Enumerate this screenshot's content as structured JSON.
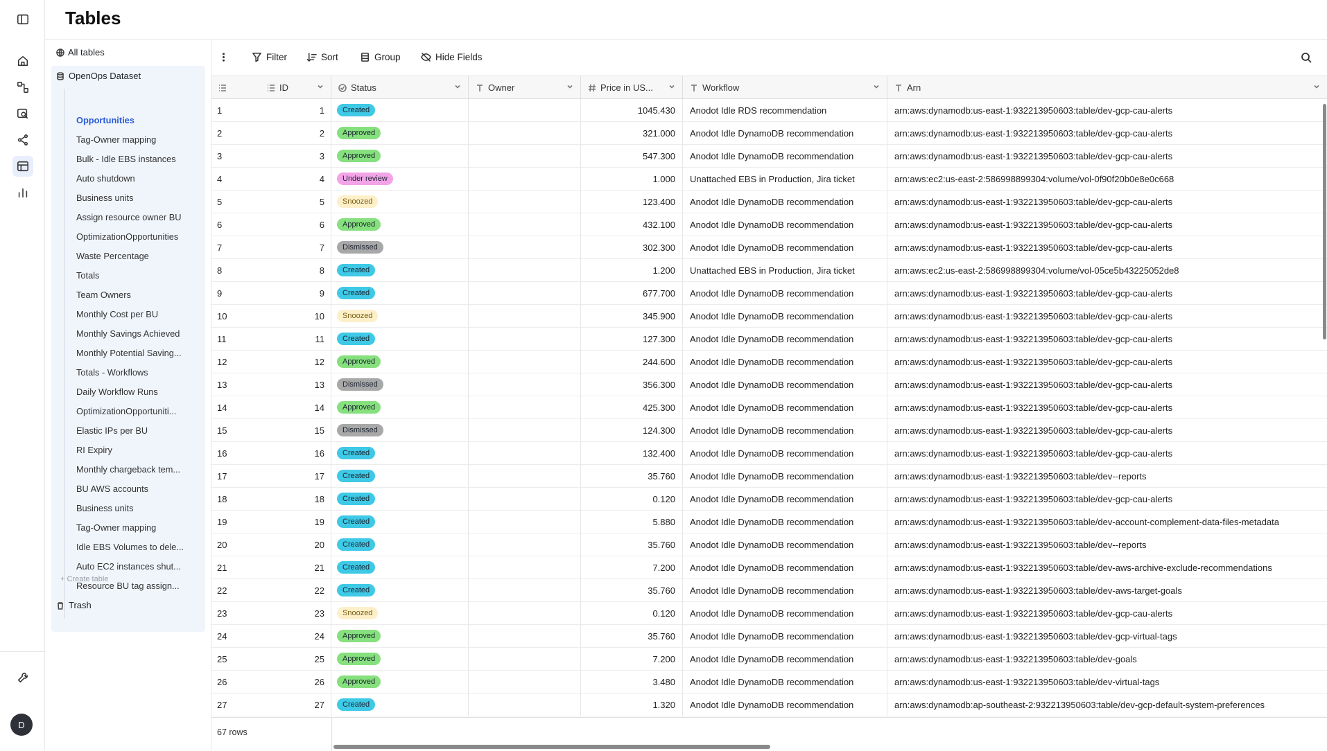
{
  "header": {
    "title": "Tables"
  },
  "sidebar": {
    "all_tables": "All tables",
    "dataset": "OpenOps Dataset",
    "tables": [
      "Opportunities",
      "Tag-Owner mapping",
      "Bulk - Idle EBS instances",
      "Auto shutdown",
      "Business units",
      "Assign resource owner BU",
      "OptimizationOpportunities",
      "Waste Percentage",
      "Totals",
      "Team Owners",
      "Monthly Cost per BU",
      "Monthly Savings Achieved",
      "Monthly Potential Saving...",
      "Totals - Workflows",
      "Daily Workflow Runs",
      "OptimizationOpportuniti...",
      "Elastic IPs per BU",
      "RI Expiry",
      "Monthly chargeback tem...",
      "BU AWS accounts",
      "Business units",
      "Tag-Owner mapping",
      "Idle EBS Volumes to dele...",
      "Auto EC2 instances shut...",
      "Resource BU tag assign..."
    ],
    "active_table": "Opportunities",
    "create_table": "+ Create table",
    "trash": "Trash"
  },
  "toolbar": {
    "filter": "Filter",
    "sort": "Sort",
    "group": "Group",
    "hide_fields": "Hide Fields"
  },
  "columns": {
    "id": "ID",
    "status": "Status",
    "owner": "Owner",
    "price": "Price in US...",
    "workflow": "Workflow",
    "arn": "Arn"
  },
  "status_colors": {
    "Created": "#3ec9e6",
    "Approved": "#86e07d",
    "Under review": "#f3a4e8",
    "Snoozed": "#fdf0c8",
    "Dismissed": "#a8a8a8"
  },
  "rows": [
    {
      "n": "1",
      "id": "1",
      "status": "Created",
      "price": "1045.430",
      "workflow": "Anodot Idle RDS recommendation",
      "arn": "arn:aws:dynamodb:us-east-1:932213950603:table/dev-gcp-cau-alerts"
    },
    {
      "n": "2",
      "id": "2",
      "status": "Approved",
      "price": "321.000",
      "workflow": "Anodot Idle DynamoDB recommendation",
      "arn": "arn:aws:dynamodb:us-east-1:932213950603:table/dev-gcp-cau-alerts"
    },
    {
      "n": "3",
      "id": "3",
      "status": "Approved",
      "price": "547.300",
      "workflow": "Anodot Idle DynamoDB recommendation",
      "arn": "arn:aws:dynamodb:us-east-1:932213950603:table/dev-gcp-cau-alerts"
    },
    {
      "n": "4",
      "id": "4",
      "status": "Under review",
      "price": "1.000",
      "workflow": "Unattached EBS in Production, Jira ticket",
      "arn": "arn:aws:ec2:us-east-2:586998899304:volume/vol-0f90f20b0e8e0c668"
    },
    {
      "n": "5",
      "id": "5",
      "status": "Snoozed",
      "price": "123.400",
      "workflow": "Anodot Idle DynamoDB recommendation",
      "arn": "arn:aws:dynamodb:us-east-1:932213950603:table/dev-gcp-cau-alerts"
    },
    {
      "n": "6",
      "id": "6",
      "status": "Approved",
      "price": "432.100",
      "workflow": "Anodot Idle DynamoDB recommendation",
      "arn": "arn:aws:dynamodb:us-east-1:932213950603:table/dev-gcp-cau-alerts"
    },
    {
      "n": "7",
      "id": "7",
      "status": "Dismissed",
      "price": "302.300",
      "workflow": "Anodot Idle DynamoDB recommendation",
      "arn": "arn:aws:dynamodb:us-east-1:932213950603:table/dev-gcp-cau-alerts"
    },
    {
      "n": "8",
      "id": "8",
      "status": "Created",
      "price": "1.200",
      "workflow": "Unattached EBS in Production, Jira ticket",
      "arn": "arn:aws:ec2:us-east-2:586998899304:volume/vol-05ce5b43225052de8"
    },
    {
      "n": "9",
      "id": "9",
      "status": "Created",
      "price": "677.700",
      "workflow": "Anodot Idle DynamoDB recommendation",
      "arn": "arn:aws:dynamodb:us-east-1:932213950603:table/dev-gcp-cau-alerts"
    },
    {
      "n": "10",
      "id": "10",
      "status": "Snoozed",
      "price": "345.900",
      "workflow": "Anodot Idle DynamoDB recommendation",
      "arn": "arn:aws:dynamodb:us-east-1:932213950603:table/dev-gcp-cau-alerts"
    },
    {
      "n": "11",
      "id": "11",
      "status": "Created",
      "price": "127.300",
      "workflow": "Anodot Idle DynamoDB recommendation",
      "arn": "arn:aws:dynamodb:us-east-1:932213950603:table/dev-gcp-cau-alerts"
    },
    {
      "n": "12",
      "id": "12",
      "status": "Approved",
      "price": "244.600",
      "workflow": "Anodot Idle DynamoDB recommendation",
      "arn": "arn:aws:dynamodb:us-east-1:932213950603:table/dev-gcp-cau-alerts"
    },
    {
      "n": "13",
      "id": "13",
      "status": "Dismissed",
      "price": "356.300",
      "workflow": "Anodot Idle DynamoDB recommendation",
      "arn": "arn:aws:dynamodb:us-east-1:932213950603:table/dev-gcp-cau-alerts"
    },
    {
      "n": "14",
      "id": "14",
      "status": "Approved",
      "price": "425.300",
      "workflow": "Anodot Idle DynamoDB recommendation",
      "arn": "arn:aws:dynamodb:us-east-1:932213950603:table/dev-gcp-cau-alerts"
    },
    {
      "n": "15",
      "id": "15",
      "status": "Dismissed",
      "price": "124.300",
      "workflow": "Anodot Idle DynamoDB recommendation",
      "arn": "arn:aws:dynamodb:us-east-1:932213950603:table/dev-gcp-cau-alerts"
    },
    {
      "n": "16",
      "id": "16",
      "status": "Created",
      "price": "132.400",
      "workflow": "Anodot Idle DynamoDB recommendation",
      "arn": "arn:aws:dynamodb:us-east-1:932213950603:table/dev-gcp-cau-alerts"
    },
    {
      "n": "17",
      "id": "17",
      "status": "Created",
      "price": "35.760",
      "workflow": "Anodot Idle DynamoDB recommendation",
      "arn": "arn:aws:dynamodb:us-east-1:932213950603:table/dev--reports"
    },
    {
      "n": "18",
      "id": "18",
      "status": "Created",
      "price": "0.120",
      "workflow": "Anodot Idle DynamoDB recommendation",
      "arn": "arn:aws:dynamodb:us-east-1:932213950603:table/dev-gcp-cau-alerts"
    },
    {
      "n": "19",
      "id": "19",
      "status": "Created",
      "price": "5.880",
      "workflow": "Anodot Idle DynamoDB recommendation",
      "arn": "arn:aws:dynamodb:us-east-1:932213950603:table/dev-account-complement-data-files-metadata"
    },
    {
      "n": "20",
      "id": "20",
      "status": "Created",
      "price": "35.760",
      "workflow": "Anodot Idle DynamoDB recommendation",
      "arn": "arn:aws:dynamodb:us-east-1:932213950603:table/dev--reports"
    },
    {
      "n": "21",
      "id": "21",
      "status": "Created",
      "price": "7.200",
      "workflow": "Anodot Idle DynamoDB recommendation",
      "arn": "arn:aws:dynamodb:us-east-1:932213950603:table/dev-aws-archive-exclude-recommendations"
    },
    {
      "n": "22",
      "id": "22",
      "status": "Created",
      "price": "35.760",
      "workflow": "Anodot Idle DynamoDB recommendation",
      "arn": "arn:aws:dynamodb:us-east-1:932213950603:table/dev-aws-target-goals"
    },
    {
      "n": "23",
      "id": "23",
      "status": "Snoozed",
      "price": "0.120",
      "workflow": "Anodot Idle DynamoDB recommendation",
      "arn": "arn:aws:dynamodb:us-east-1:932213950603:table/dev-gcp-cau-alerts"
    },
    {
      "n": "24",
      "id": "24",
      "status": "Approved",
      "price": "35.760",
      "workflow": "Anodot Idle DynamoDB recommendation",
      "arn": "arn:aws:dynamodb:us-east-1:932213950603:table/dev-gcp-virtual-tags"
    },
    {
      "n": "25",
      "id": "25",
      "status": "Approved",
      "price": "7.200",
      "workflow": "Anodot Idle DynamoDB recommendation",
      "arn": "arn:aws:dynamodb:us-east-1:932213950603:table/dev-goals"
    },
    {
      "n": "26",
      "id": "26",
      "status": "Approved",
      "price": "3.480",
      "workflow": "Anodot Idle DynamoDB recommendation",
      "arn": "arn:aws:dynamodb:us-east-1:932213950603:table/dev-virtual-tags"
    },
    {
      "n": "27",
      "id": "27",
      "status": "Created",
      "price": "1.320",
      "workflow": "Anodot Idle DynamoDB recommendation",
      "arn": "arn:aws:dynamodb:ap-southeast-2:932213950603:table/dev-gcp-default-system-preferences"
    }
  ],
  "footer": {
    "row_count": "67 rows"
  },
  "user": {
    "avatar_initial": "D"
  }
}
